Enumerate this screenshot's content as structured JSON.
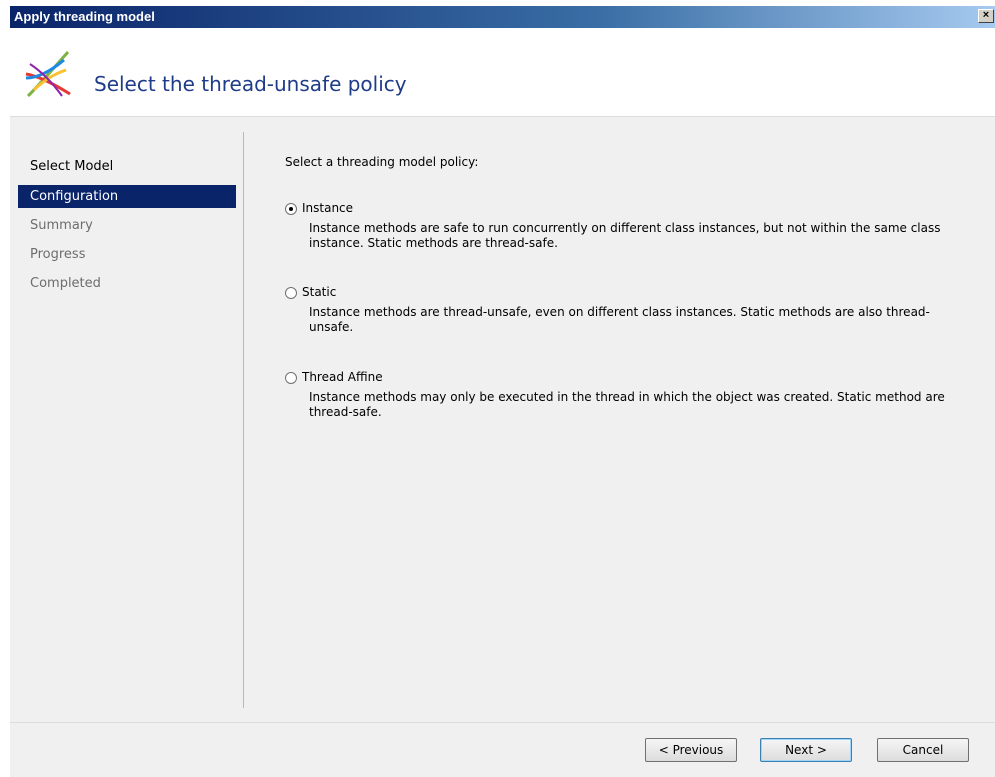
{
  "window": {
    "title": "Apply threading model",
    "close_label": "×"
  },
  "header": {
    "title": "Select the thread-unsafe policy",
    "logo_icon": "crossed-threads-icon"
  },
  "nav": {
    "items": [
      {
        "label": "Select Model",
        "state": "done"
      },
      {
        "label": "Configuration",
        "state": "active"
      },
      {
        "label": "Summary",
        "state": "pending"
      },
      {
        "label": "Progress",
        "state": "pending"
      },
      {
        "label": "Completed",
        "state": "pending"
      }
    ]
  },
  "main": {
    "prompt": "Select a threading model policy:",
    "options": [
      {
        "label": "Instance",
        "checked": true,
        "description": "Instance methods are safe to run concurrently on different class instances, but not within the same class instance. Static methods are thread-safe."
      },
      {
        "label": "Static",
        "checked": false,
        "description": "Instance methods are thread-unsafe, even on different class instances. Static methods are also thread-unsafe."
      },
      {
        "label": "Thread Affine",
        "checked": false,
        "description": "Instance methods may only be executed in the thread in which the object was created. Static method are thread-safe."
      }
    ]
  },
  "footer": {
    "previous_label": "< Previous",
    "next_label": "Next >",
    "cancel_label": "Cancel"
  },
  "colors": {
    "title_bar": "#0a246a",
    "header_title": "#1f3c88",
    "nav_active_bg": "#0a246a",
    "nav_pending_text": "#6d6d6d",
    "panel_bg": "#f0f0f0"
  }
}
